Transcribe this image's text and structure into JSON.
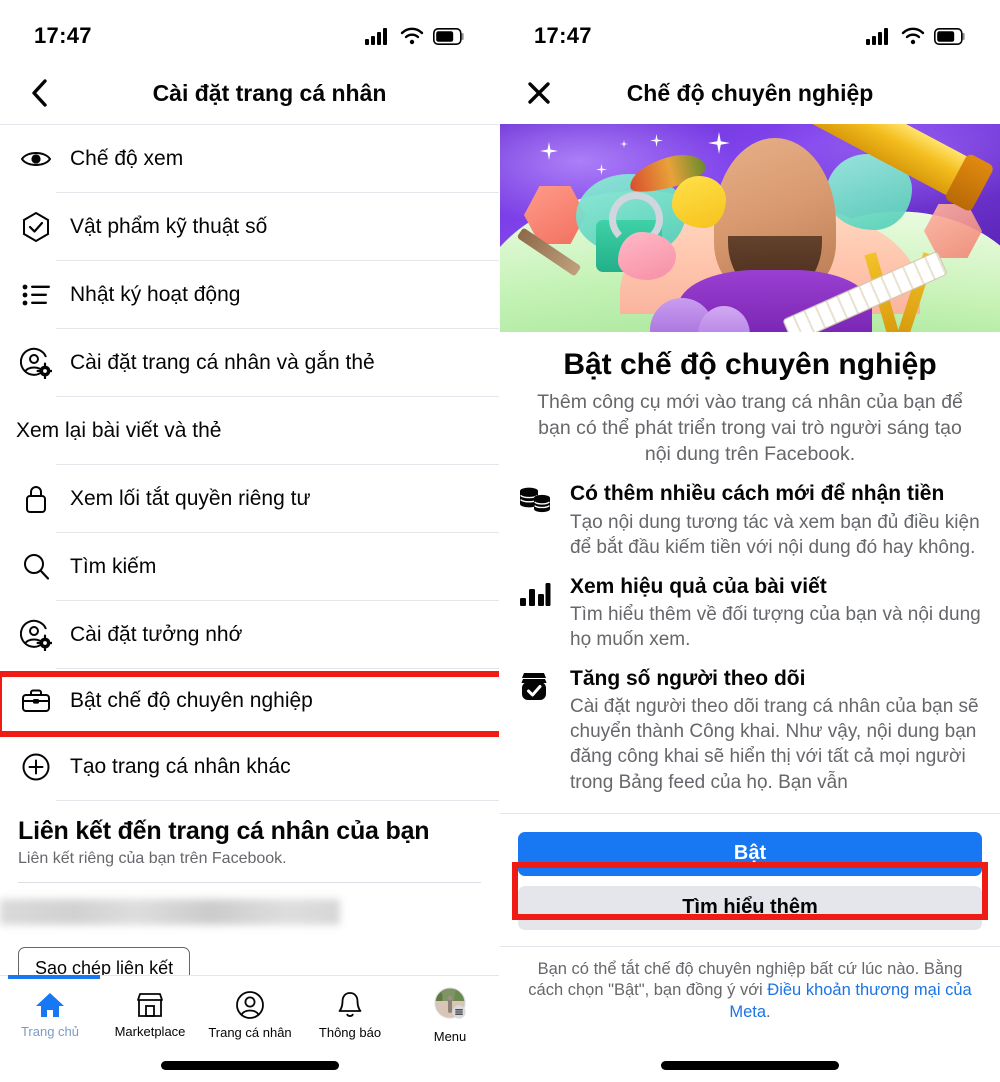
{
  "left": {
    "status": {
      "time": "17:47",
      "signal_icon": "cellular-signal-icon",
      "wifi_icon": "wifi-icon",
      "battery_icon": "battery-icon"
    },
    "nav": {
      "back_icon": "chevron-left-icon",
      "title": "Cài đặt trang cá nhân"
    },
    "menu": [
      {
        "icon": "eye-icon",
        "label": "Chế độ xem"
      },
      {
        "icon": "shield-check-icon",
        "label": "Vật phẩm kỹ thuật số"
      },
      {
        "icon": "activity-log-icon",
        "label": "Nhật ký hoạt động"
      },
      {
        "icon": "profile-settings-icon",
        "label": "Cài đặt trang cá nhân và gắn thẻ"
      },
      {
        "icon": "",
        "label": "Xem lại bài viết và thẻ"
      },
      {
        "icon": "lock-icon",
        "label": "Xem lối tắt quyền riêng tư"
      },
      {
        "icon": "search-icon",
        "label": "Tìm kiếm"
      },
      {
        "icon": "memorial-settings-icon",
        "label": "Cài đặt tưởng nhớ"
      },
      {
        "icon": "briefcase-icon",
        "label": "Bật chế độ chuyên nghiệp"
      },
      {
        "icon": "plus-circle-icon",
        "label": "Tạo trang cá nhân khác"
      }
    ],
    "link_section": {
      "title": "Liên kết đến trang cá nhân của bạn",
      "subtitle": "Liên kết riêng của bạn trên Facebook.",
      "url_value": "",
      "copy_label": "Sao chép liên kết"
    },
    "tabbar": [
      {
        "icon": "home-icon",
        "label": "Trang chủ",
        "active": true
      },
      {
        "icon": "marketplace-icon",
        "label": "Marketplace",
        "active": false
      },
      {
        "icon": "profile-icon",
        "label": "Trang cá nhân",
        "active": false
      },
      {
        "icon": "bell-icon",
        "label": "Thông báo",
        "active": false
      },
      {
        "icon": "menu-avatar-icon",
        "label": "Menu",
        "active": false
      }
    ]
  },
  "right": {
    "status": {
      "time": "17:47",
      "signal_icon": "cellular-signal-icon",
      "wifi_icon": "wifi-icon",
      "battery_icon": "battery-icon"
    },
    "nav": {
      "close_icon": "close-x-icon",
      "title": "Chế độ chuyên nghiệp"
    },
    "hero": {
      "illustration_name": "professional-mode-hero-illustration"
    },
    "title": "Bật chế độ chuyên nghiệp",
    "subtitle": "Thêm công cụ mới vào trang cá nhân của bạn để bạn có thể phát triển trong vai trò người sáng tạo nội dung trên Facebook.",
    "features": [
      {
        "icon": "coins-stack-icon",
        "title": "Có thêm nhiều cách mới để nhận tiền",
        "desc": "Tạo nội dung tương tác và xem bạn đủ điều kiện để bắt đầu kiếm tiền với nội dung đó hay không."
      },
      {
        "icon": "bar-chart-icon",
        "title": "Xem hiệu quả của bài viết",
        "desc": "Tìm hiểu thêm về đối tượng của bạn và nội dung họ muốn xem."
      },
      {
        "icon": "followers-badge-icon",
        "title": "Tăng số người theo dõi",
        "desc": "Cài đặt người theo dõi trang cá nhân của bạn sẽ chuyển thành Công khai. Như vậy, nội dung bạn đăng công khai sẽ hiển thị với tất cả mọi người trong Bảng feed của họ. Bạn vẫn"
      }
    ],
    "primary_button": "Bật",
    "secondary_button": "Tìm hiểu thêm",
    "footnote_pre": "Bạn có thể tắt chế độ chuyên nghiệp bất cứ lúc nào. Bằng cách chọn \"Bật\", bạn đồng ý với ",
    "footnote_link": "Điều khoản thương mại của Meta",
    "footnote_post": "."
  },
  "annotations": {
    "highlight_color": "#ee1c15",
    "boxes": [
      {
        "name": "highlight-box-professional-mode-row"
      },
      {
        "name": "highlight-box-enable-button"
      }
    ]
  },
  "colors": {
    "accent": "#1877f2",
    "link": "#1b74e4",
    "muted": "#65676b",
    "text": "#050505",
    "divider": "#e4e6eb",
    "highlight": "#ee1c15"
  }
}
